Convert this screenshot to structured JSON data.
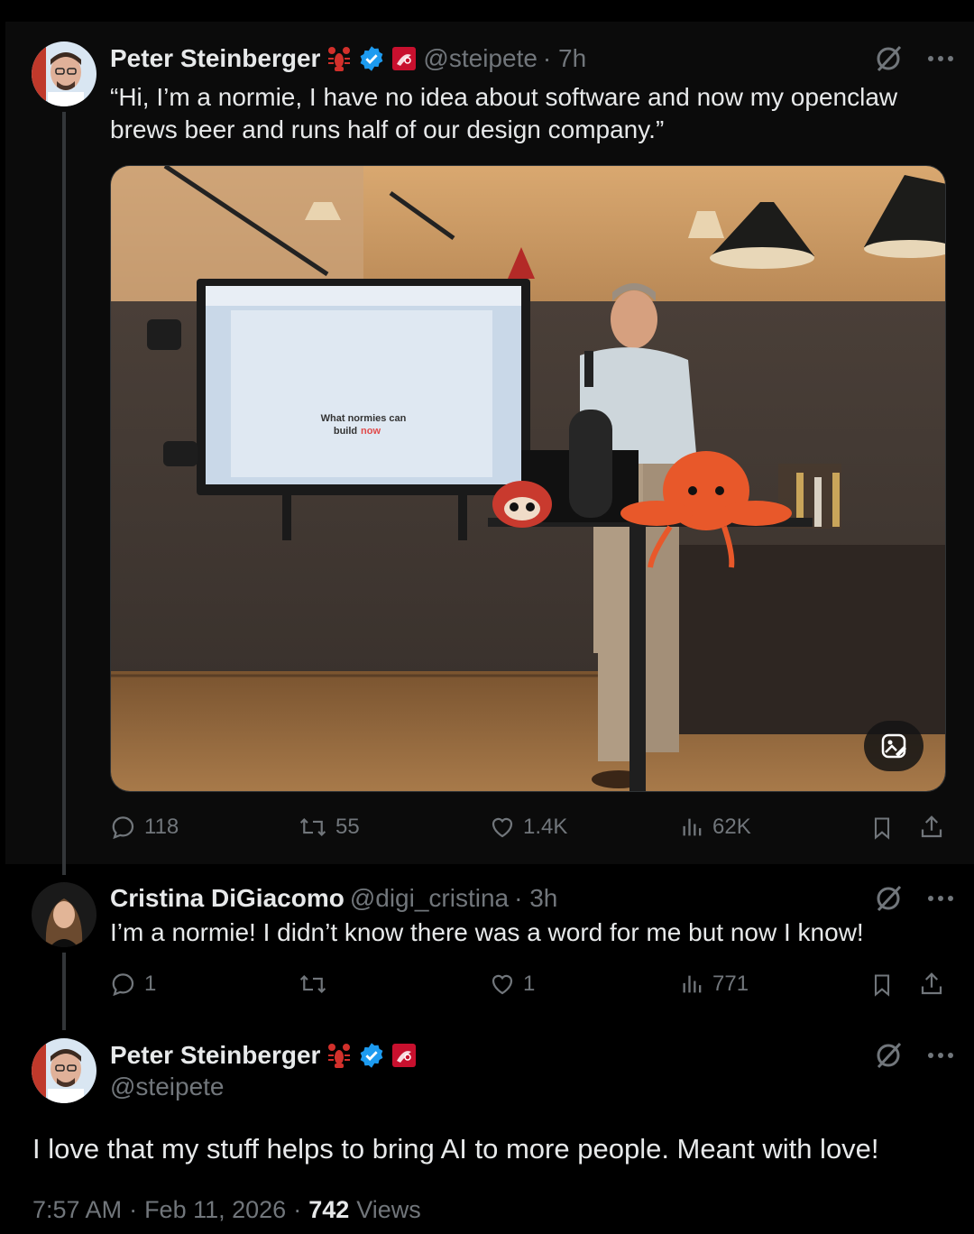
{
  "colors": {
    "accent": "#1d9bf0",
    "bg": "#000000",
    "muted": "#71767b",
    "text": "#e7e9ea"
  },
  "tweet1": {
    "name": "Peter Steinberger",
    "handle": "@steipete",
    "time": "· 7h",
    "text": "“Hi, I’m a normie, I have no idea about software and now my openclaw brews beer and runs half of our design company.”",
    "media": {
      "screen_title": "What normies can",
      "screen_title_2": "build",
      "screen_title_highlight": "now"
    },
    "replies": "118",
    "reposts": "55",
    "likes": "1.4K",
    "views": "62K"
  },
  "tweet2": {
    "name": "Cristina DiGiacomo",
    "handle": "@digi_cristina",
    "time": "· 3h",
    "text": "I’m a normie! I didn’t know there was a word for me but now I know!",
    "replies": "1",
    "reposts": "",
    "likes": "1",
    "views": "771"
  },
  "tweet3": {
    "name": "Peter Steinberger",
    "handle": "@steipete",
    "text": "I love that my stuff helps to bring AI to more people. Meant with love!",
    "time": "7:57 AM",
    "date": "Feb 11, 2026",
    "sep1": "·",
    "sep2": "·",
    "views_count": "742",
    "views_label": "Views"
  },
  "icons": [
    "reply-icon",
    "repost-icon",
    "like-icon",
    "views-icon",
    "bookmark-icon",
    "share-icon",
    "grok-icon",
    "more-icon",
    "verified-icon",
    "lobster-icon",
    "flag-icon",
    "alt-text-icon"
  ]
}
